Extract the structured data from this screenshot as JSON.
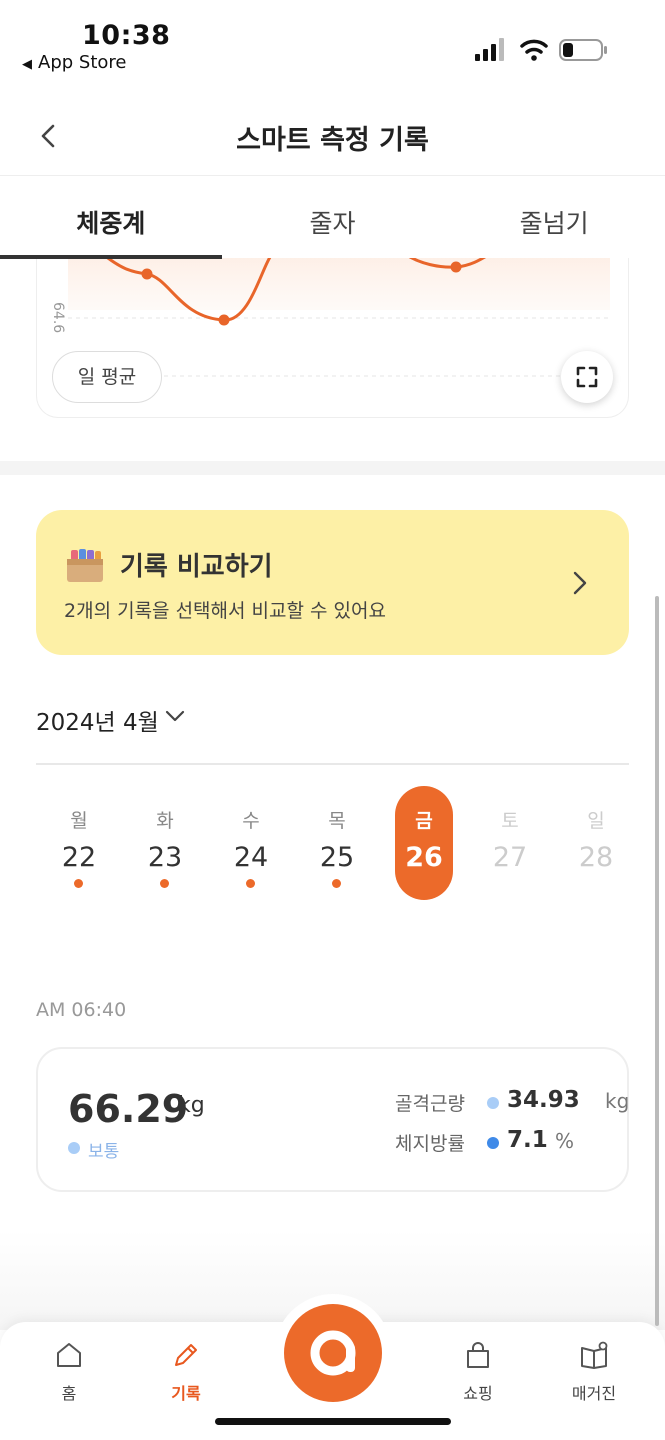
{
  "status_bar": {
    "time": "10:38",
    "back_app": "App Store",
    "icons": [
      "signal-icon",
      "wifi-icon",
      "battery-icon"
    ]
  },
  "nav": {
    "title": "스마트 측정 기록",
    "back_icon": "chevron-left-icon"
  },
  "tabs": [
    {
      "label": "체중계",
      "active": true
    },
    {
      "label": "줄자",
      "active": false
    },
    {
      "label": "줄넘기",
      "active": false
    }
  ],
  "chart": {
    "y_tick_label": "64.6",
    "average_toggle": "일 평균",
    "expand_icon": "expand-icon",
    "line_color": "#e8652a"
  },
  "compare_banner": {
    "title": "기록 비교하기",
    "subtitle": "2개의 기록을 선택해서 비교할 수 있어요",
    "icon": "box-icon",
    "background": "#fdf0a6"
  },
  "month_selector": {
    "label": "2024년 4월"
  },
  "week": [
    {
      "weekday": "월",
      "date": "22",
      "has_record": true,
      "state": "normal"
    },
    {
      "weekday": "화",
      "date": "23",
      "has_record": true,
      "state": "normal"
    },
    {
      "weekday": "수",
      "date": "24",
      "has_record": true,
      "state": "normal"
    },
    {
      "weekday": "목",
      "date": "25",
      "has_record": true,
      "state": "normal"
    },
    {
      "weekday": "금",
      "date": "26",
      "has_record": false,
      "state": "selected"
    },
    {
      "weekday": "토",
      "date": "27",
      "has_record": false,
      "state": "future"
    },
    {
      "weekday": "일",
      "date": "28",
      "has_record": false,
      "state": "future"
    }
  ],
  "record": {
    "time": "AM 06:40",
    "weight": "66.29",
    "weight_unit": "kg",
    "status": "보통",
    "metrics": [
      {
        "label": "골격근량",
        "value": "34.93",
        "unit": "kg",
        "dot_color": "#a9cdf7"
      },
      {
        "label": "체지방률",
        "value": "7.1",
        "unit": "%",
        "dot_color": "#3f8ae8"
      }
    ]
  },
  "bottom_nav": [
    {
      "label": "홈",
      "icon": "home-icon",
      "active": false
    },
    {
      "label": "기록",
      "icon": "pencil-icon",
      "active": true
    },
    {
      "label": "쇼핑",
      "icon": "shopping-bag-icon",
      "active": false
    },
    {
      "label": "매거진",
      "icon": "magazine-icon",
      "active": false
    }
  ],
  "accent_color": "#ec6a2a"
}
